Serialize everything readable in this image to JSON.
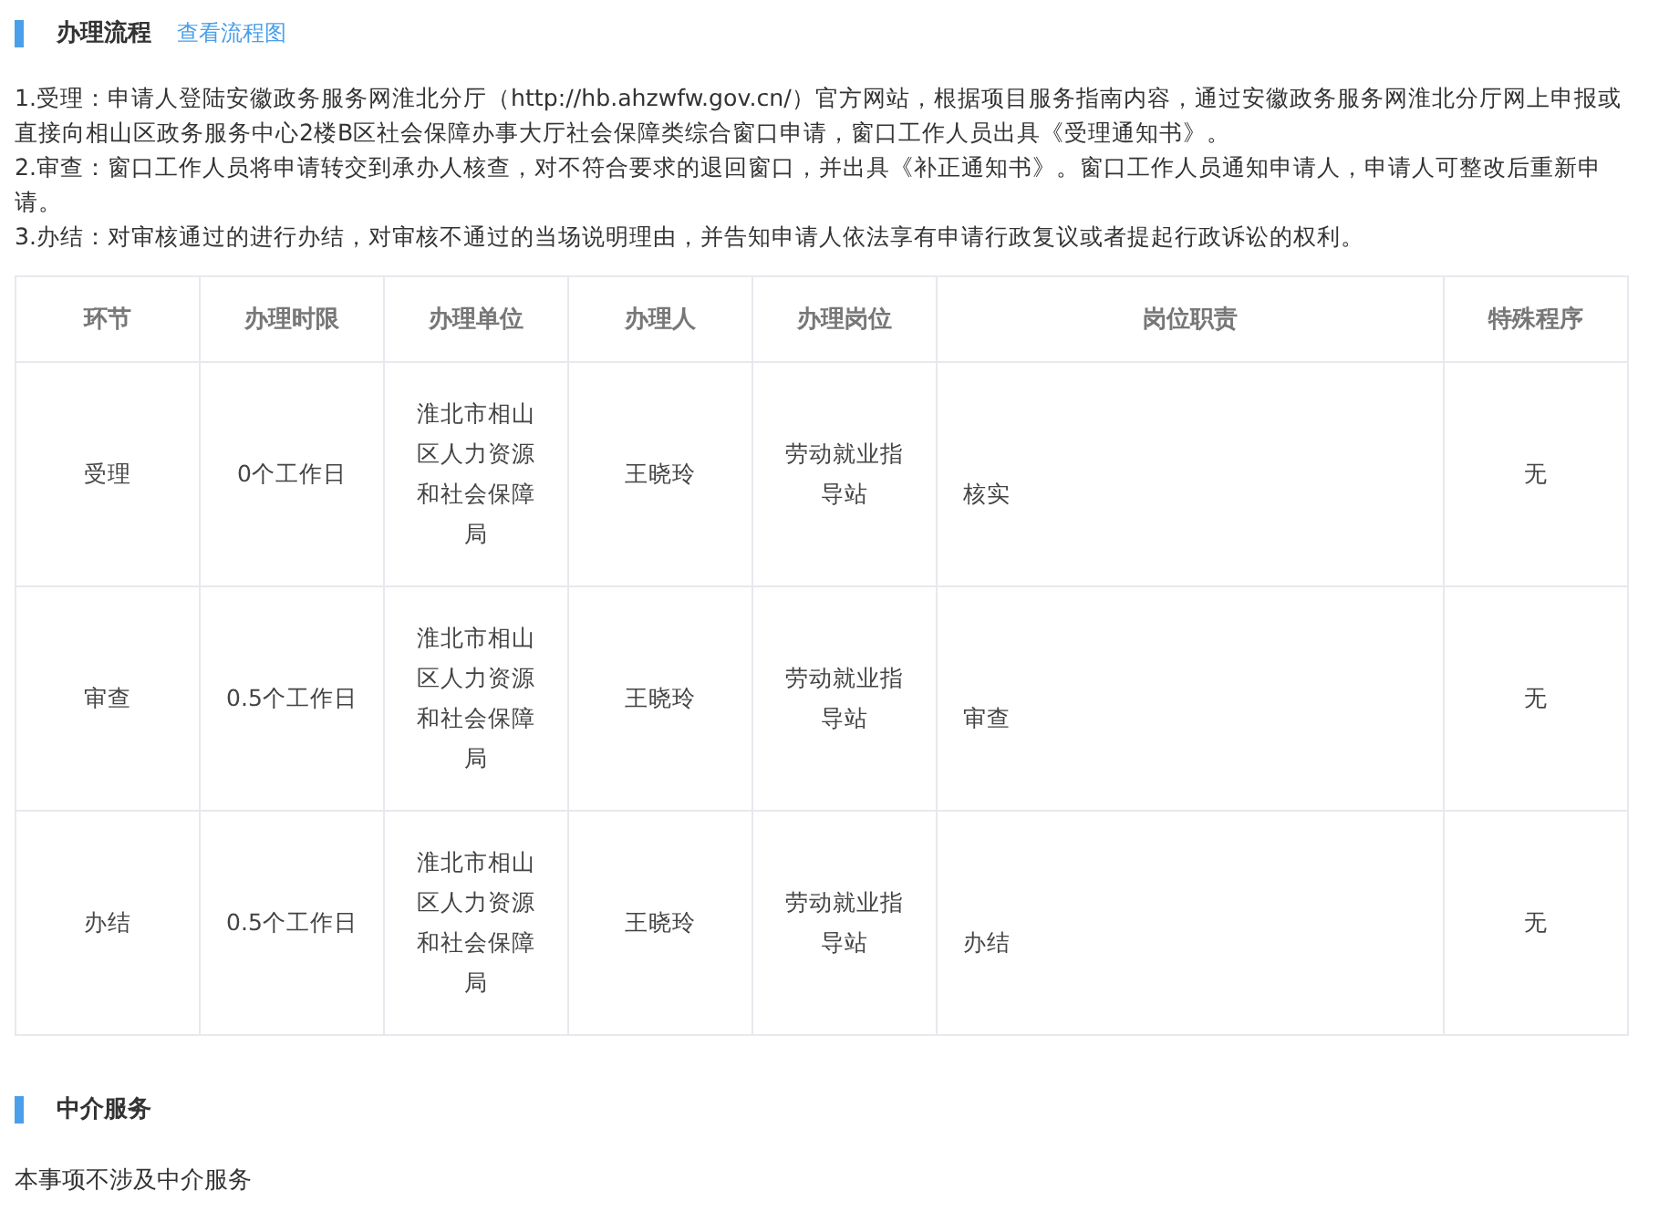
{
  "process_section": {
    "title": "办理流程",
    "link": "查看流程图",
    "steps": [
      "1.受理：申请人登陆安徽政务服务网淮北分厅（http://hb.ahzwfw.gov.cn/）官方网站，根据项目服务指南内容，通过安徽政务服务网淮北分厅网上申报或直接向相山区政务服务中心2楼B区社会保障办事大厅社会保障类综合窗口申请，窗口工作人员出具《受理通知书》。",
      "2.审查：窗口工作人员将申请转交到承办人核查，对不符合要求的退回窗口，并出具《补正通知书》。窗口工作人员通知申请人，申请人可整改后重新申请。",
      "3.办结：对审核通过的进行办结，对审核不通过的当场说明理由，并告知申请人依法享有申请行政复议或者提起行政诉讼的权利。"
    ],
    "table": {
      "columns": [
        "环节",
        "办理时限",
        "办理单位",
        "办理人",
        "办理岗位",
        "岗位职责",
        "特殊程序"
      ],
      "rows": [
        [
          "受理",
          "0个工作日",
          "淮北市相山区人力资源和社会保障局",
          "王晓玲",
          "劳动就业指导站",
          "核实",
          "无"
        ],
        [
          "审查",
          "0.5个工作日",
          "淮北市相山区人力资源和社会保障局",
          "王晓玲",
          "劳动就业指导站",
          "审查",
          "无"
        ],
        [
          "办结",
          "0.5个工作日",
          "淮北市相山区人力资源和社会保障局",
          "王晓玲",
          "劳动就业指导站",
          "办结",
          "无"
        ]
      ]
    }
  },
  "intermediary_section": {
    "title": "中介服务",
    "text": "本事项不涉及中介服务"
  }
}
